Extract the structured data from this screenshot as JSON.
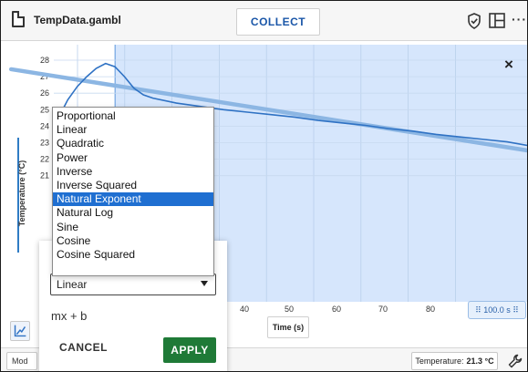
{
  "header": {
    "filename": "TempData.gambl",
    "collect_label": "COLLECT",
    "icons": [
      "shield-check-icon",
      "layout-grid-icon",
      "more-icon"
    ],
    "more_glyph": "···"
  },
  "graph": {
    "close_glyph": "×",
    "y_label": "Temperature (°C)",
    "x_label": "Time (s)",
    "range_chip": "⠿ 100.0 s ⠿",
    "selection_color": "#cfe2fb",
    "data_color": "#2f72c4",
    "fit_color": "#8cb6e3"
  },
  "chart_data": {
    "type": "line",
    "xlabel": "Time (s)",
    "ylabel": "Temperature (°C)",
    "x_ticks": [
      "40",
      "50",
      "60",
      "70",
      "80"
    ],
    "y_ticks": [
      "28",
      "27",
      "26",
      "25",
      "24",
      "23",
      "22",
      "21"
    ],
    "ylim": [
      20.5,
      28.5
    ],
    "xlim": [
      0,
      100
    ],
    "series": [
      {
        "x": [
          0,
          2,
          4,
          6,
          8,
          10,
          12,
          14,
          16,
          18,
          20,
          25,
          30,
          35,
          40,
          45,
          50,
          55,
          60,
          65,
          70,
          75,
          80,
          85,
          90,
          95,
          100
        ],
        "y": [
          24.5,
          25.6,
          26.4,
          27.0,
          27.5,
          27.8,
          27.6,
          27.0,
          26.3,
          25.9,
          25.7,
          25.4,
          25.2,
          25.0,
          24.85,
          24.7,
          24.55,
          24.35,
          24.2,
          24.05,
          23.85,
          23.7,
          23.5,
          23.35,
          23.2,
          23.05,
          22.8
        ]
      }
    ],
    "fit_line": {
      "x": [
        -10,
        100
      ],
      "y": [
        27.45,
        22.5
      ]
    }
  },
  "fit_panel": {
    "selected": "Linear",
    "equation": "mx + b",
    "cancel_label": "CANCEL",
    "apply_label": "APPLY",
    "options": [
      "Proportional",
      "Linear",
      "Quadratic",
      "Power",
      "Inverse",
      "Inverse Squared",
      "Natural Exponent",
      "Natural Log",
      "Sine",
      "Cosine",
      "Cosine Squared"
    ],
    "highlighted_option": "Natural Exponent"
  },
  "footer": {
    "mod_label": "Mod",
    "temp_prefix": "Temperature:",
    "temp_value": "21.3 °C"
  }
}
